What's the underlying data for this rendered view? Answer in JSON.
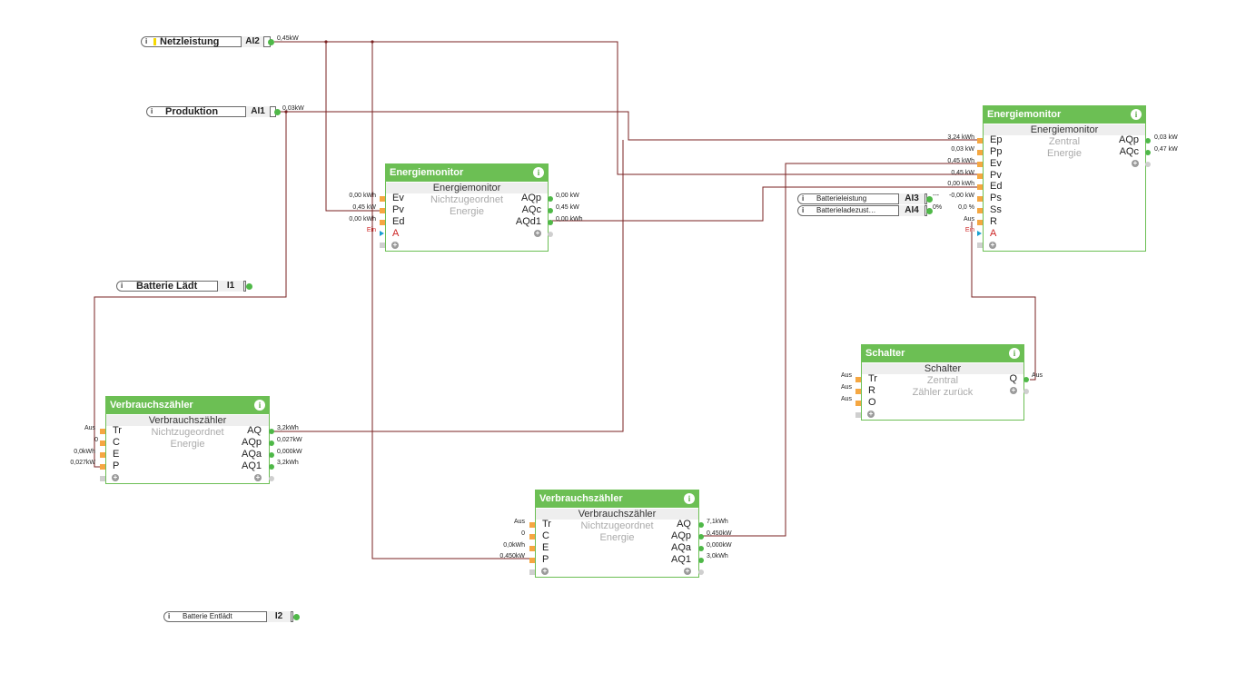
{
  "colors": {
    "wire": "#7a2222",
    "block_header": "#6cbf54",
    "port_output": "#4fb848",
    "port_input": "#f5a742",
    "flag": "#f5d800"
  },
  "info_icon": "i",
  "add_icon": "+",
  "io": {
    "netzleistung": {
      "name": "Netzleistung",
      "code": "AI2",
      "value": "0,45kW"
    },
    "produktion": {
      "name": "Produktion",
      "code": "AI1",
      "value": "0,03kW"
    },
    "batterie_laedt": {
      "name": "Batterie Lädt",
      "code": "I1"
    },
    "batterie_entlaedt": {
      "name": "Batterie Entlädt",
      "code": "I2"
    },
    "batterieleistung": {
      "name": "Batterieleistung",
      "code": "AI3"
    },
    "batterieladezustand": {
      "name": "Batterieladezust…",
      "code": "AI4"
    }
  },
  "em1": {
    "title": "Energiemonitor",
    "subtitle": "Energiemonitor",
    "room": "Nichtzugeordnet",
    "category": "Energie",
    "inputs": [
      {
        "pin": "Ev",
        "value": "0,00 kWh"
      },
      {
        "pin": "Pv",
        "value": "0,45 kW"
      },
      {
        "pin": "Ed",
        "value": "0,00 kWh"
      },
      {
        "pin": "A",
        "value": "Ein"
      }
    ],
    "outputs": [
      {
        "pin": "AQp",
        "value": "0,00 kW"
      },
      {
        "pin": "AQc",
        "value": "0,45 kW"
      },
      {
        "pin": "AQd1",
        "value": "0,00 kWh"
      }
    ]
  },
  "em2": {
    "title": "Energiemonitor",
    "subtitle": "Energiemonitor",
    "room": "Zentral",
    "category": "Energie",
    "inputs": [
      {
        "pin": "Ep",
        "value": "3,24 kWh"
      },
      {
        "pin": "Pp",
        "value": "0,03 kW"
      },
      {
        "pin": "Ev",
        "value": "0,45 kWh"
      },
      {
        "pin": "Pv",
        "value": "0,45 kW"
      },
      {
        "pin": "Ed",
        "value": "0,00 kWh"
      },
      {
        "pin": "Ps",
        "value": "-0,00 kW"
      },
      {
        "pin": "Ss",
        "value": "0,0 %"
      },
      {
        "pin": "R",
        "value": "Aus"
      },
      {
        "pin": "A",
        "value": "Ein"
      }
    ],
    "outputs": [
      {
        "pin": "AQp",
        "value": "0,03 kW"
      },
      {
        "pin": "AQc",
        "value": "0,47 kW"
      }
    ],
    "ps_extra": "---",
    "ss_extra": "0%"
  },
  "schalter": {
    "title": "Schalter",
    "subtitle": "Schalter",
    "room": "Zentral",
    "category": "Zähler zurück",
    "inputs": [
      {
        "pin": "Tr",
        "value": "Aus"
      },
      {
        "pin": "R",
        "value": "Aus"
      },
      {
        "pin": "O",
        "value": "Aus"
      }
    ],
    "outputs": [
      {
        "pin": "Q",
        "value": "Aus"
      }
    ]
  },
  "vz1": {
    "title": "Verbrauchszähler",
    "subtitle": "Verbrauchszähler",
    "room": "Nichtzugeordnet",
    "category": "Energie",
    "inputs": [
      {
        "pin": "Tr",
        "value": "Aus"
      },
      {
        "pin": "C",
        "value": "0"
      },
      {
        "pin": "E",
        "value": "0,0kWh"
      },
      {
        "pin": "P",
        "value": "0,027kW"
      }
    ],
    "outputs": [
      {
        "pin": "AQ",
        "value": "3,2kWh"
      },
      {
        "pin": "AQp",
        "value": "0,027kW"
      },
      {
        "pin": "AQa",
        "value": "0,000kW"
      },
      {
        "pin": "AQ1",
        "value": "3,2kWh"
      }
    ]
  },
  "vz2": {
    "title": "Verbrauchszähler",
    "subtitle": "Verbrauchszähler",
    "room": "Nichtzugeordnet",
    "category": "Energie",
    "inputs": [
      {
        "pin": "Tr",
        "value": "Aus"
      },
      {
        "pin": "C",
        "value": "0"
      },
      {
        "pin": "E",
        "value": "0,0kWh"
      },
      {
        "pin": "P",
        "value": "0,450kW"
      }
    ],
    "outputs": [
      {
        "pin": "AQ",
        "value": "7,1kWh"
      },
      {
        "pin": "AQp",
        "value": "0,450kW"
      },
      {
        "pin": "AQa",
        "value": "0,000kW"
      },
      {
        "pin": "AQ1",
        "value": "3,0kWh"
      }
    ]
  }
}
